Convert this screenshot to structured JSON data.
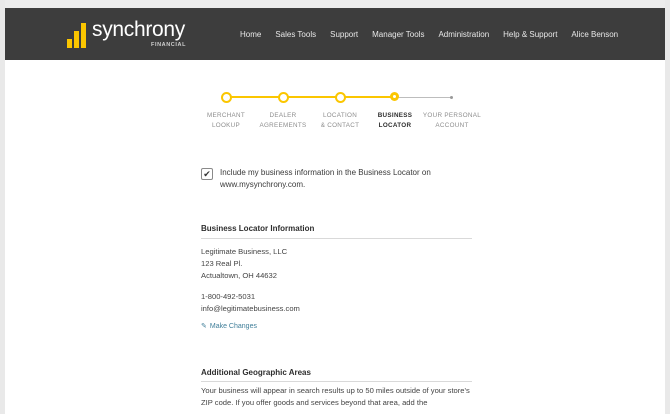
{
  "header": {
    "logo_text": "synchrony",
    "logo_subtext": "FINANCIAL",
    "brand_color": "#fbc600",
    "nav": [
      "Home",
      "Sales Tools",
      "Support",
      "Manager Tools",
      "Administration",
      "Help & Support",
      "Alice Benson"
    ]
  },
  "steps": [
    {
      "line1": "MERCHANT",
      "line2": "LOOKUP",
      "state": "done"
    },
    {
      "line1": "DEALER",
      "line2": "AGREEMENTS",
      "state": "done"
    },
    {
      "line1": "LOCATION",
      "line2": "& CONTACT",
      "state": "done"
    },
    {
      "line1": "BUSINESS",
      "line2": "LOCATOR",
      "state": "current"
    },
    {
      "line1": "YOUR PERSONAL",
      "line2": "ACCOUNT",
      "state": "future"
    }
  ],
  "include_checkbox": {
    "checked": true,
    "label": "Include my business information in the Business Locator on www.mysynchrony.com."
  },
  "locator": {
    "title": "Business Locator Information",
    "name": "Legitimate Business, LLC",
    "street": "123 Real Pl.",
    "city": "Actualtown, OH 44632",
    "phone": "1-800-492-5031",
    "email": "info@legitimatebusiness.com",
    "make_changes": "Make Changes"
  },
  "geo": {
    "title": "Additional Geographic Areas",
    "text": "Your business will appear in search results up to 50 miles outside of your store's ZIP code. If you offer goods and services beyond that area, add the"
  }
}
